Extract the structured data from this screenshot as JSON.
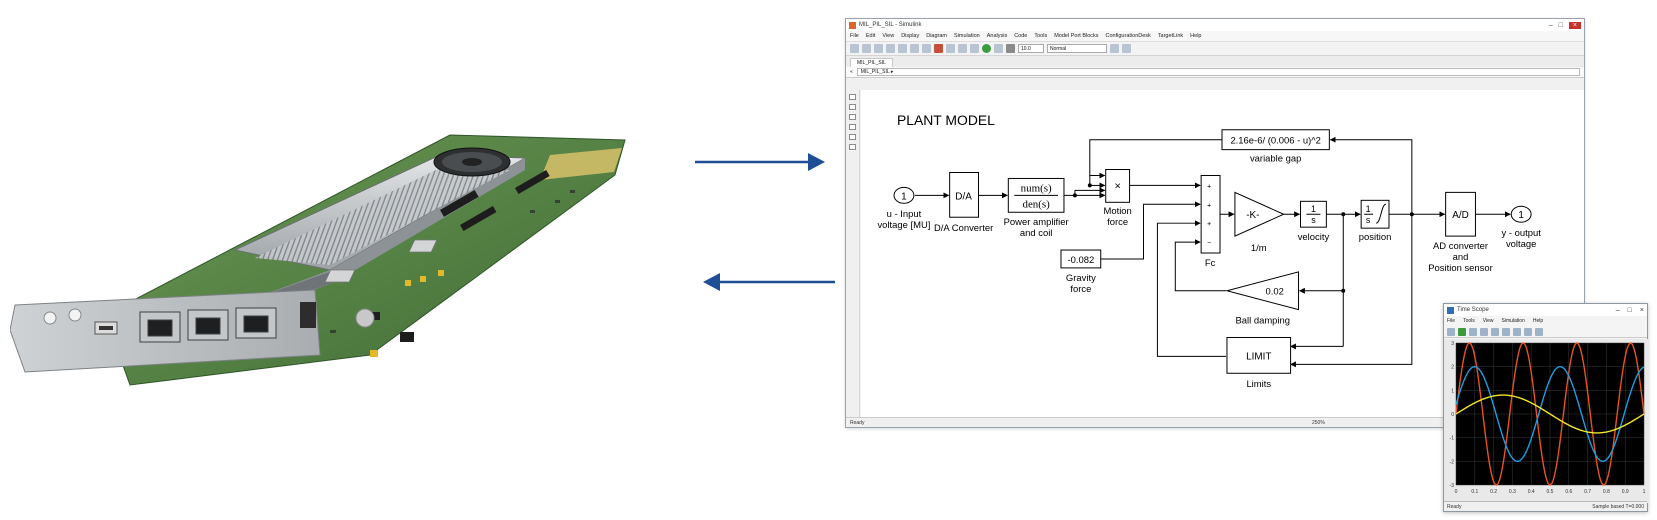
{
  "simulink": {
    "window_title": "MIL_PIL_SIL - Simulink",
    "menu": [
      "File",
      "Edit",
      "View",
      "Display",
      "Diagram",
      "Simulation",
      "Analysis",
      "Code",
      "Tools",
      "Model Port Blocks",
      "ConfigurationDesk",
      "TargetLink",
      "Help"
    ],
    "stop_time": "10.0",
    "sim_mode": "Normal",
    "tab": "MIL_PIL_SIL",
    "breadcrumb": "MIL_PIL_SIL ▸",
    "status": "Ready",
    "zoom": "250%"
  },
  "model": {
    "title": "PLANT MODEL",
    "in_port_number": "1",
    "in_port_label": "u - Input voltage [MU]",
    "da_block": "D/A",
    "da_label": "D/A Converter",
    "tf_num": "num(s)",
    "tf_den": "den(s)",
    "tf_label": "Power amplifier and coil",
    "product_symbol": "×",
    "product_label": "Motion force",
    "gap_expr": "2.16e-6/ (0.006 - u)^2",
    "gap_label": "variable gap",
    "gravity_value": "-0.082",
    "gravity_label": "Gravity force",
    "sum_signs": [
      "+",
      "+",
      "+",
      "−"
    ],
    "sum_label": "Fc",
    "gain_value": "-K-",
    "gain_label": "1/m",
    "int_num": "1",
    "int_den": "s",
    "int1_label": "velocity",
    "int2_label": "position",
    "damping_value": "0.02",
    "damping_label": "Ball damping",
    "limit_block": "LIMIT",
    "limit_label": "Limits",
    "ad_block": "A/D",
    "ad_label": "AD converter and Position sensor",
    "out_port_number": "1",
    "out_port_label": "y - output voltage"
  },
  "scope": {
    "title": "Time Scope",
    "menu": [
      "File",
      "Tools",
      "View",
      "Simulation",
      "Help"
    ],
    "status": "Ready",
    "sample_info": "Sample based  T=0.000",
    "y_ticks": [
      "3",
      "2",
      "1",
      "0",
      "-1",
      "-2",
      "-3"
    ],
    "x_ticks": [
      "0",
      "0.1",
      "0.2",
      "0.3",
      "0.4",
      "0.5",
      "0.6",
      "0.7",
      "0.8",
      "0.9",
      "1"
    ],
    "colors": {
      "plot_bg": "#000000",
      "grid": "#3a3a3a",
      "axis_text": "#cfcfcf"
    }
  },
  "chart_data": {
    "type": "line",
    "xlim": [
      0,
      1
    ],
    "ylim": [
      -3,
      3
    ],
    "grid": true,
    "series": [
      {
        "color": "#e8531f",
        "amplitude": 3.0,
        "cycles": 3.5,
        "phase": 0.0
      },
      {
        "color": "#1c9ee3",
        "amplitude": 2.0,
        "cycles": 2.2,
        "phase": 0.2
      },
      {
        "color": "#f2e62a",
        "amplitude": 0.8,
        "cycles": 1.0,
        "phase": 0.0
      }
    ]
  },
  "colors": {
    "arrow": "#1f4e96",
    "board_pcb": "#4e7d3e",
    "heatsink": "#b9bdc0"
  }
}
